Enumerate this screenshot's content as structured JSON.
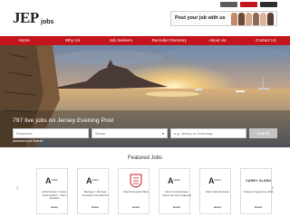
{
  "header": {
    "logo_main": "JEP",
    "logo_sub": "jobs",
    "utility_buttons": [
      "",
      "",
      ""
    ],
    "post_banner": "Post your job with us"
  },
  "nav": {
    "items": [
      "Home",
      "Why Us",
      "Job Seekers",
      "Recruiter Directory",
      "About Us",
      "Contact Us"
    ]
  },
  "hero": {
    "live_count": "797 live jobs on Jersey Evening Post",
    "keywords_placeholder": "Keywords",
    "sector_placeholder": "Sector",
    "location_placeholder": "e.g. Jersey or Guernsey",
    "search_label": "Search",
    "advanced_link": "Advanced job Search"
  },
  "featured": {
    "title": "Featured Jobs",
    "cards": [
      {
        "title": "Administrator / Senior Administrator - Client Services",
        "location": "Jersey",
        "logo": "apex"
      },
      {
        "title": "Manager / AD level Financial Crime/MLCO",
        "location": "Jersey",
        "logo": "apex"
      },
      {
        "title": "Chief Financial Officer",
        "location": "Jersey",
        "logo": "crest"
      },
      {
        "title": "Senior Administrator (Client Services Support)",
        "location": "Jersey",
        "logo": "apex"
      },
      {
        "title": "Client Risk Reviewer",
        "location": "Jersey",
        "logo": "apex"
      },
      {
        "title": "Trainee Programme 2022",
        "location": "Jersey",
        "logo": "CAREY OLSEN"
      }
    ]
  },
  "colors": {
    "brand_red": "#c4141c",
    "search_button": "#c4c4c4"
  }
}
